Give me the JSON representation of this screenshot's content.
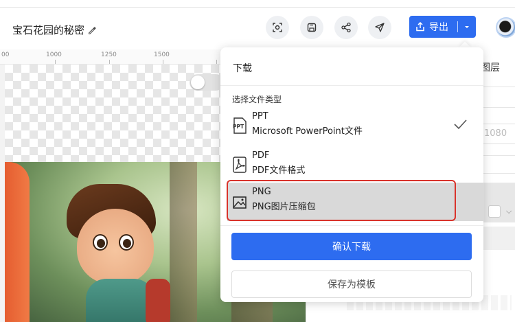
{
  "header": {
    "doc_title": "宝石花园的秘密",
    "export_label": "导出"
  },
  "ruler": {
    "labels": [
      "00",
      "1000",
      "1250",
      "1500"
    ]
  },
  "right_panel": {
    "layers_label": "图层",
    "input_placeholder": "1080"
  },
  "download_menu": {
    "title": "下载",
    "section_label": "选择文件类型",
    "options": [
      {
        "name": "PPT",
        "desc": "Microsoft PowerPoint文件",
        "icon": "ppt-file-icon",
        "checked": true
      },
      {
        "name": "PDF",
        "desc": "PDF文件格式",
        "icon": "pdf-file-icon",
        "checked": false
      },
      {
        "name": "PNG",
        "desc": "PNG图片压缩包",
        "icon": "image-file-icon",
        "checked": false,
        "highlighted": true
      }
    ],
    "confirm_label": "确认下载",
    "template_label": "保存为模板"
  },
  "colors": {
    "accent": "#2d6cf0",
    "highlight_border": "#d9332b"
  }
}
